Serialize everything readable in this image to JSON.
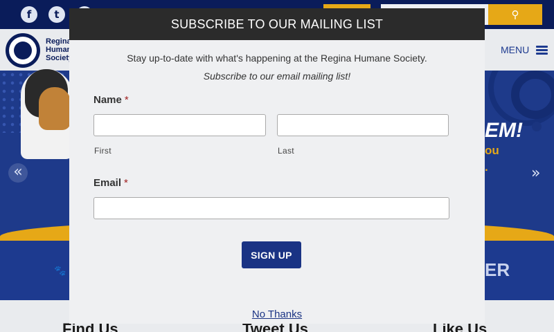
{
  "site": {
    "logo_text": "Regina Humane Society",
    "menu_label": "MENU",
    "hero": {
      "headline_fragment": "EM!",
      "sub_fragment": "ou",
      "dot_fragment": "."
    },
    "bluebar_fragment": "ER",
    "footer_headings": [
      "Find Us",
      "Tweet Us",
      "Like Us"
    ],
    "social_icons": [
      "facebook-icon",
      "twitter-icon",
      "instagram-icon"
    ],
    "colors": {
      "navy": "#0a1c5a",
      "blue": "#1e3a8a",
      "gold": "#e6a817"
    }
  },
  "modal": {
    "title": "SUBSCRIBE TO OUR MAILING LIST",
    "intro": "Stay up-to-date with what's happening at the Regina Humane Society.",
    "subtitle": "Subscribe to our email mailing list!",
    "name_label": "Name",
    "required_mark": "*",
    "first_label": "First",
    "last_label": "Last",
    "email_label": "Email",
    "first_value": "",
    "last_value": "",
    "email_value": "",
    "signup_label": "SIGN UP",
    "no_thanks_label": "No Thanks"
  }
}
